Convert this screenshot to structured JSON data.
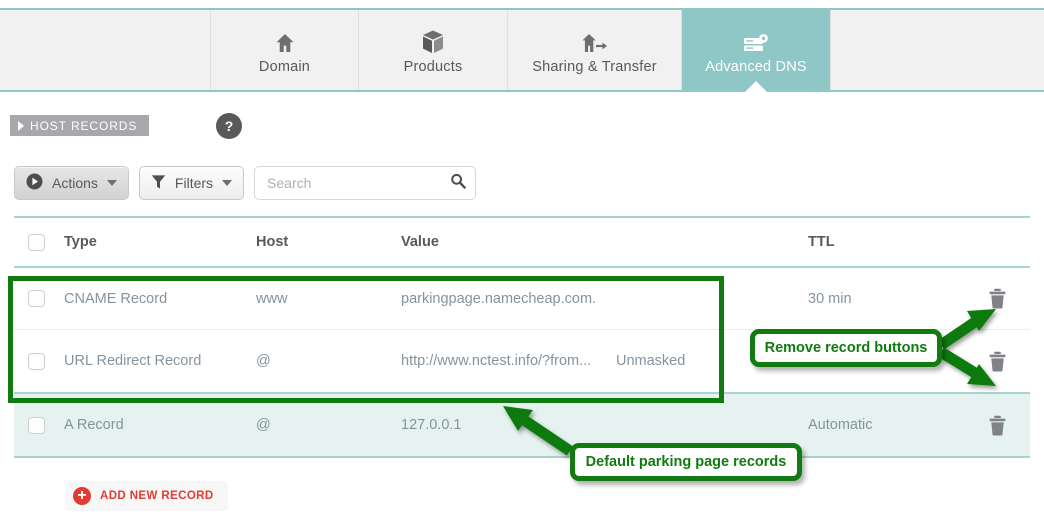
{
  "tabs": [
    {
      "id": "domain",
      "label": "Domain",
      "icon": "house-icon",
      "active": false
    },
    {
      "id": "products",
      "label": "Products",
      "icon": "box-icon",
      "active": false
    },
    {
      "id": "sharing",
      "label": "Sharing & Transfer",
      "icon": "share-icon",
      "active": false
    },
    {
      "id": "dns",
      "label": "Advanced DNS",
      "icon": "server-icon",
      "active": true
    }
  ],
  "section": {
    "ribbon_label": "HOST RECORDS",
    "help_badge": "?"
  },
  "toolbar": {
    "actions_label": "Actions",
    "filters_label": "Filters",
    "search_placeholder": "Search",
    "search_value": ""
  },
  "table": {
    "headers": {
      "type": "Type",
      "host": "Host",
      "value": "Value",
      "extra": "",
      "ttl": "TTL"
    },
    "rows": [
      {
        "type": "CNAME Record",
        "host": "www",
        "value": "parkingpage.namecheap.com.",
        "extra": "",
        "ttl": "30 min",
        "highlight": false
      },
      {
        "type": "URL Redirect Record",
        "host": "@",
        "value": "http://www.nctest.info/?from...",
        "extra": "Unmasked",
        "ttl": "",
        "highlight": false
      },
      {
        "type": "A Record",
        "host": "@",
        "value": "127.0.0.1",
        "extra": "",
        "ttl": "Automatic",
        "highlight": true
      }
    ]
  },
  "add_record": {
    "label": "ADD NEW RECORD",
    "plus": "+"
  },
  "annotations": [
    {
      "id": "remove",
      "text": "Remove record buttons"
    },
    {
      "id": "default",
      "text": "Default parking page records"
    }
  ],
  "colors": {
    "accent_teal": "#8fc6c6",
    "rule_teal": "#a9d2d2",
    "row_highlight": "#e6f2f0",
    "annotation_green": "#117a11",
    "add_record_red": "#e03c32",
    "ribbon_gray": "#a6a8ab"
  }
}
